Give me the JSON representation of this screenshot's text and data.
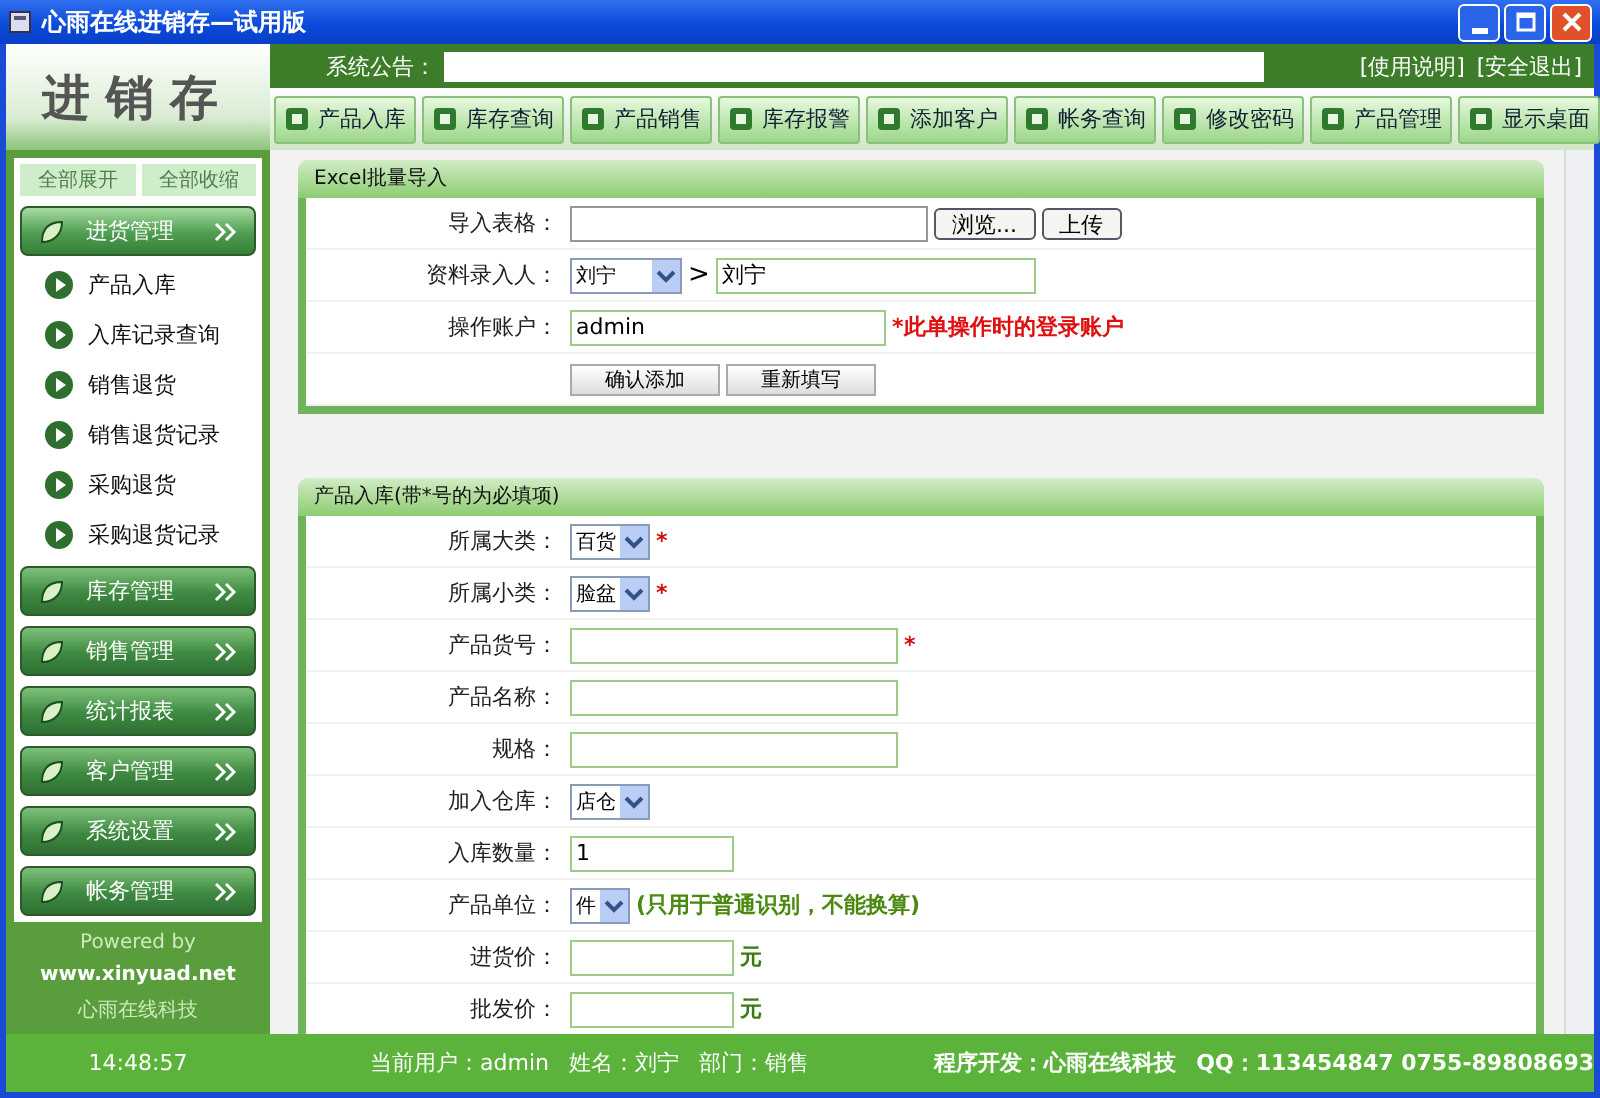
{
  "window": {
    "title": "心雨在线进销存—试用版"
  },
  "header": {
    "logo": "进销存",
    "notice_label": "系统公告：",
    "links": [
      "[使用说明]",
      "[安全退出]"
    ]
  },
  "toolbar": [
    "产品入库",
    "库存查询",
    "产品销售",
    "库存报警",
    "添加客户",
    "帐务查询",
    "修改密码",
    "产品管理",
    "显示桌面"
  ],
  "sidebar": {
    "top_buttons": [
      {
        "label": "全部展开",
        "disabled": true
      },
      {
        "label": "全部收缩",
        "disabled": true
      }
    ],
    "groups": [
      {
        "label": "进货管理",
        "expanded": true,
        "children": [
          {
            "label": "产品入库"
          },
          {
            "label": "入库记录查询"
          },
          {
            "label": "销售退货"
          },
          {
            "label": "销售退货记录"
          },
          {
            "label": "采购退货"
          },
          {
            "label": "采购退货记录"
          }
        ]
      },
      {
        "label": "库存管理",
        "expanded": false
      },
      {
        "label": "销售管理",
        "expanded": false
      },
      {
        "label": "统计报表",
        "expanded": false
      },
      {
        "label": "客户管理",
        "expanded": false
      },
      {
        "label": "系统设置",
        "expanded": false
      },
      {
        "label": "帐务管理",
        "expanded": false
      }
    ],
    "powered_by": "Powered by",
    "website": "www.xinyuad.net",
    "company": "心雨在线科技"
  },
  "panels": [
    {
      "title": "Excel批量导入",
      "rows": [
        {
          "kind": "file",
          "label": "导入表格：",
          "buttons": [
            "浏览...",
            "上传"
          ]
        },
        {
          "kind": "select_text",
          "label": "资料录入人：",
          "select": "刘宁",
          "separator": ">",
          "value": "刘宁"
        },
        {
          "kind": "text",
          "label": "操作账户：",
          "value": "admin",
          "note": "*此单操作时的登录账户",
          "color": "#e01010"
        },
        {
          "kind": "buttons",
          "buttons": [
            "确认添加",
            "重新填写"
          ]
        }
      ]
    },
    {
      "title": "产品入库(带*号的为必填项)",
      "rows": [
        {
          "kind": "select",
          "label": "所属大类：",
          "value": "百货",
          "required_mark": "*"
        },
        {
          "kind": "select",
          "label": "所属小类：",
          "value": "脸盆",
          "required_mark": "*"
        },
        {
          "kind": "text",
          "label": "产品货号：",
          "required_mark": "*"
        },
        {
          "kind": "text",
          "label": "产品名称："
        },
        {
          "kind": "text",
          "label": "规格："
        },
        {
          "kind": "select",
          "label": "加入仓库：",
          "value": "店仓"
        },
        {
          "kind": "number",
          "label": "入库数量：",
          "value": "1"
        },
        {
          "kind": "select",
          "label": "产品单位：",
          "value": "件",
          "note": "(只用于普通识别，不能换算)",
          "color": "#4a8a10"
        },
        {
          "kind": "number",
          "label": "进货价：",
          "unit": "元"
        },
        {
          "kind": "number",
          "label": "批发价：",
          "unit": "元"
        }
      ]
    }
  ],
  "status_bar": {
    "clock": "14:48:57",
    "user": "当前用户：admin",
    "name": "姓名：刘宁",
    "department": "部门：销售",
    "developer": "程序开发：心雨在线科技",
    "contact": "QQ：113454847 0755-89808693"
  }
}
